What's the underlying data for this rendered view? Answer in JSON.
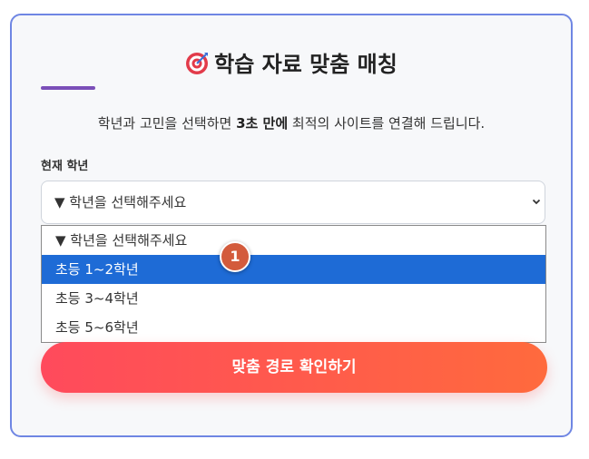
{
  "header": {
    "title": "학습 자료 맞춤 매칭",
    "title_icon": "target-icon"
  },
  "intro": {
    "before": "학년과 고민을 선택하면 ",
    "emphasis": "3초 만에",
    "after": " 최적의 사이트를 연결해 드립니다."
  },
  "grade_field": {
    "label": "현재 학년",
    "selected_value": "▼ 학년을 선택해주세요",
    "options": [
      "▼ 학년을 선택해주세요",
      "초등 1~2학년",
      "초등 3~4학년",
      "초등 5~6학년"
    ],
    "highlighted_index": 1
  },
  "annotation": {
    "badge_number": "1"
  },
  "submit": {
    "label": "맞춤 경로 확인하기"
  },
  "colors": {
    "card_border": "#6f86e3",
    "accent_line": "#7b4fb8",
    "option_highlight": "#1e6bd6",
    "badge": "#d35b3c",
    "button_start": "#ff4a5c",
    "button_end": "#ff6a3d"
  }
}
